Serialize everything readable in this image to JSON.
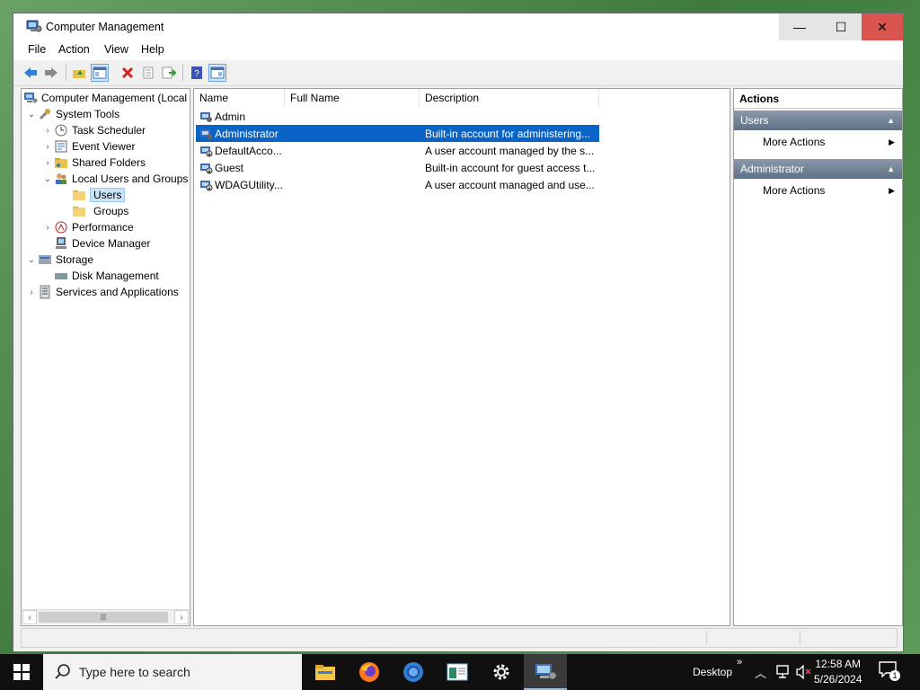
{
  "window": {
    "title": "Computer Management",
    "controls": {
      "minimize": "—",
      "maximize": "☐",
      "close": "✕"
    }
  },
  "menu": [
    "File",
    "Action",
    "View",
    "Help"
  ],
  "tree": {
    "root": "Computer Management (Local",
    "system_tools": "System Tools",
    "task_scheduler": "Task Scheduler",
    "event_viewer": "Event Viewer",
    "shared_folders": "Shared Folders",
    "local_users": "Local Users and Groups",
    "users": "Users",
    "groups": "Groups",
    "performance": "Performance",
    "device_manager": "Device Manager",
    "storage": "Storage",
    "disk_management": "Disk Management",
    "services": "Services and Applications"
  },
  "list": {
    "columns": [
      "Name",
      "Full Name",
      "Description"
    ],
    "rows": [
      {
        "name": "Admin",
        "full_name": "",
        "description": ""
      },
      {
        "name": "Administrator",
        "full_name": "",
        "description": "Built-in account for administering..."
      },
      {
        "name": "DefaultAcco...",
        "full_name": "",
        "description": "A user account managed by the s..."
      },
      {
        "name": "Guest",
        "full_name": "",
        "description": "Built-in account for guest access t..."
      },
      {
        "name": "WDAGUtility...",
        "full_name": "",
        "description": "A user account managed and use..."
      }
    ]
  },
  "actions": {
    "header": "Actions",
    "section1": "Users",
    "section1_item": "More Actions",
    "section2": "Administrator",
    "section2_item": "More Actions"
  },
  "taskbar": {
    "search_placeholder": "Type here to search",
    "desktop_label": "Desktop",
    "time": "12:58 AM",
    "date": "5/26/2024",
    "notification_count": "1"
  },
  "colors": {
    "selection": "#0a64c8",
    "tree_selection": "#cce4f7",
    "action_section": "#5f7186"
  }
}
